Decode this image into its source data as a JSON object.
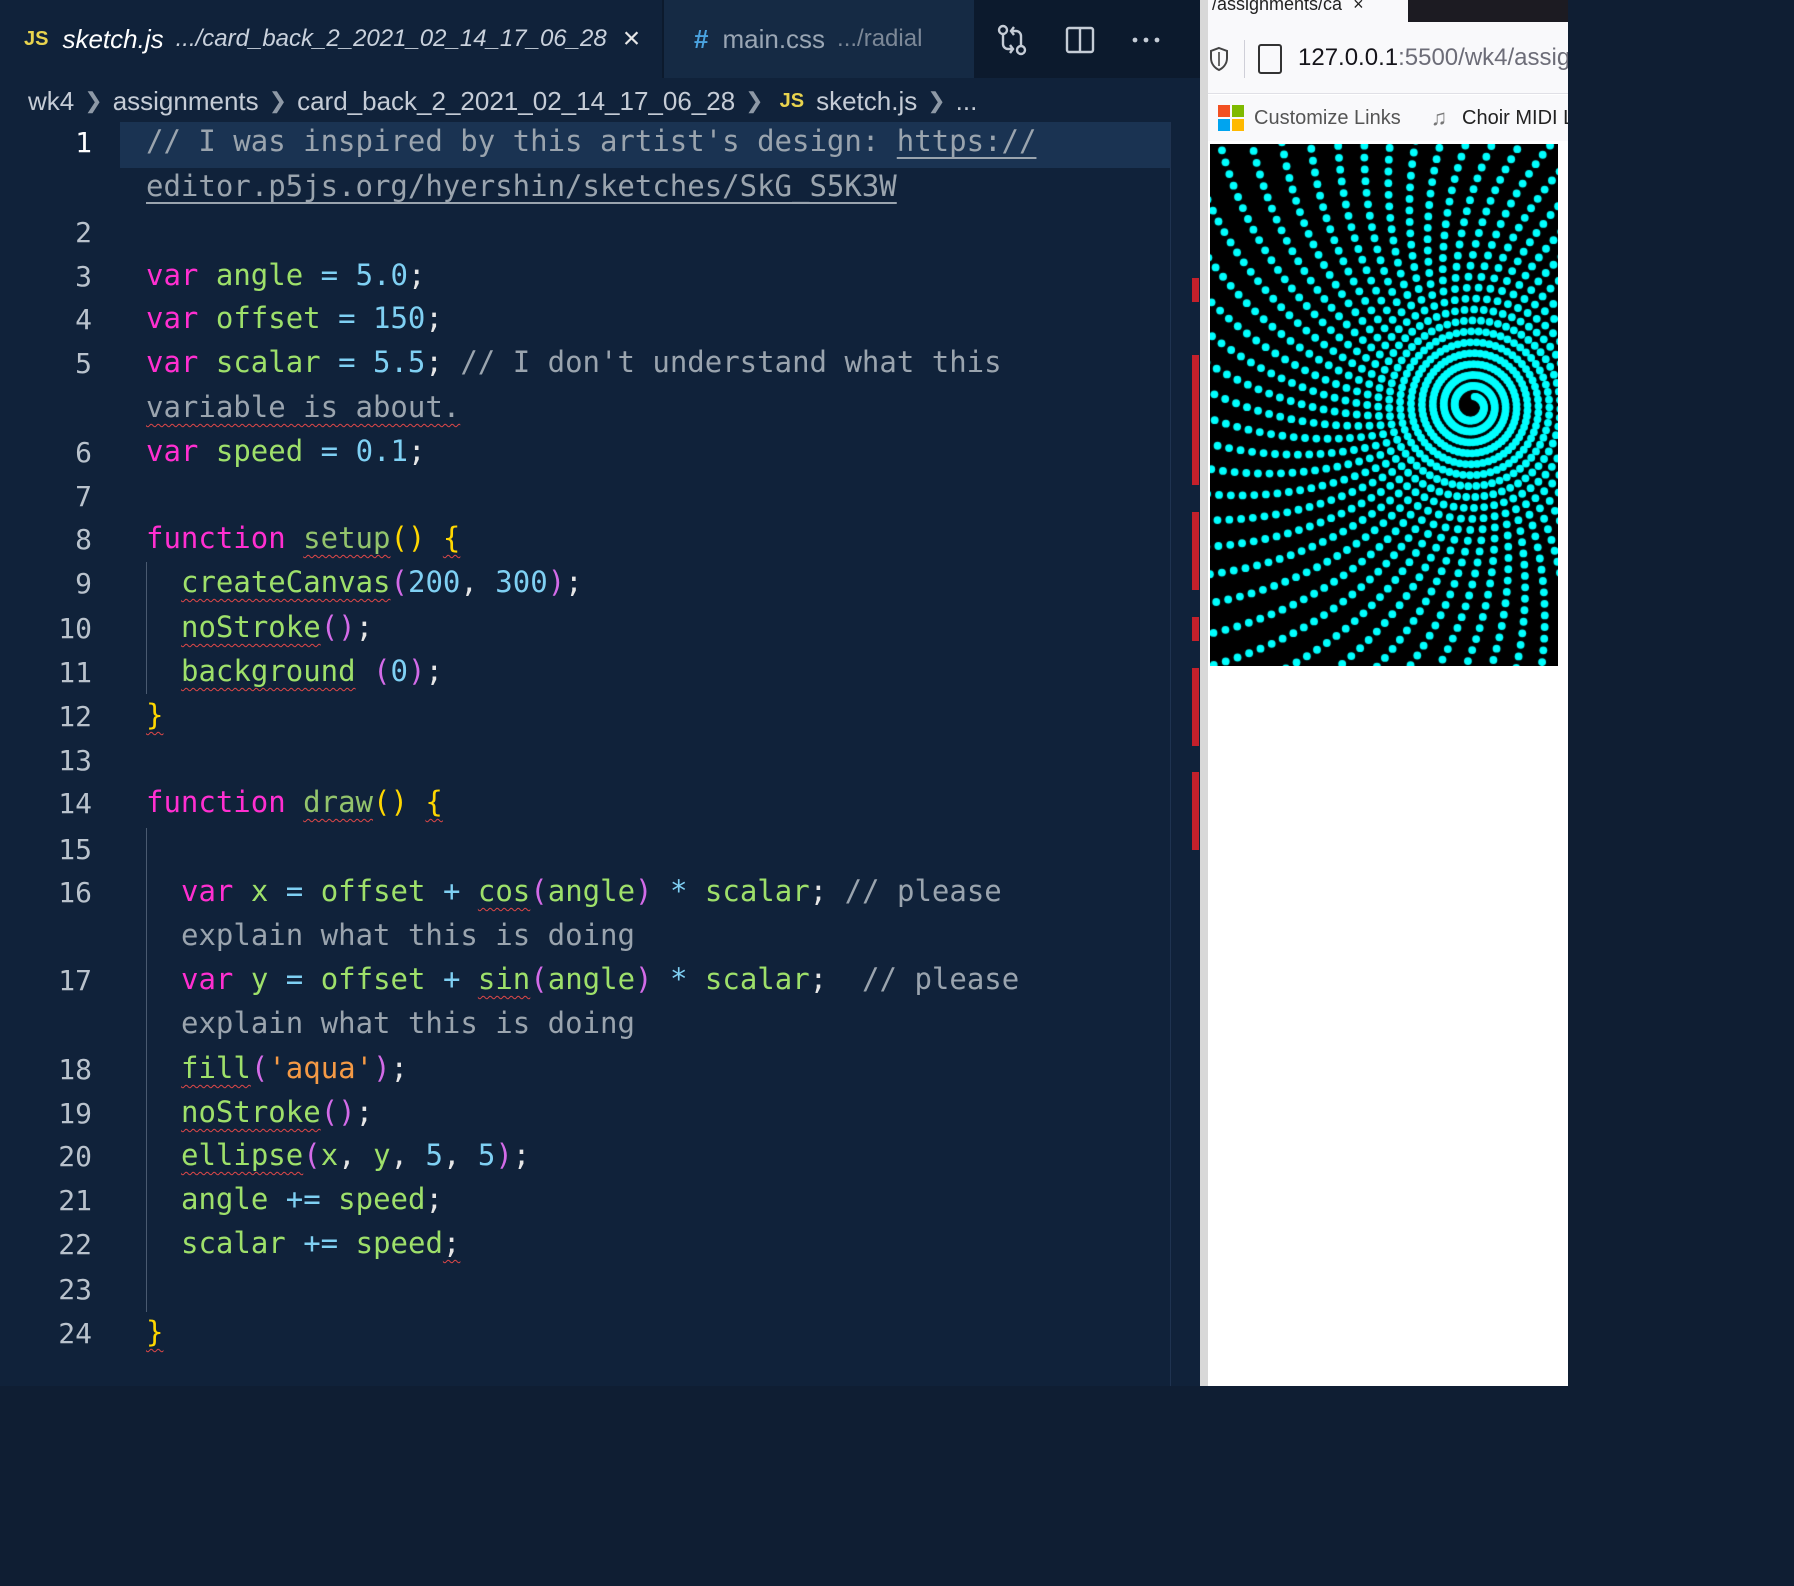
{
  "editor": {
    "tabs": [
      {
        "name": "sketch.js",
        "path": ".../card_back_2_2021_02_14_17_06_28",
        "badge": "JS",
        "active": true
      },
      {
        "name": "main.css",
        "path": ".../radial",
        "badge": "#",
        "active": false
      }
    ],
    "toolbar_icons": [
      "compare-changes-icon",
      "split-editor-icon",
      "more-actions-icon"
    ],
    "breadcrumb": [
      "wk4",
      "assignments",
      "card_back_2_2021_02_14_17_06_28",
      "sketch.js",
      "..."
    ],
    "breadcrumb_badge": "JS",
    "line_numbers": [
      "1",
      "2",
      "3",
      "4",
      "5",
      "6",
      "7",
      "8",
      "9",
      "10",
      "11",
      "12",
      "13",
      "14",
      "15",
      "16",
      "17",
      "18",
      "19",
      "20",
      "21",
      "22",
      "23",
      "24"
    ],
    "active_line": "1"
  },
  "code": {
    "l1": {
      "a": "// I was inspired by this artist's design: ",
      "link_a": "https://",
      "link_b": "editor.p5js.org/hyershin/sketches/SkG_S5K3W"
    },
    "l3": {
      "kw": "var",
      "id": "angle",
      "op": " = ",
      "val": "5.0",
      "end": ";"
    },
    "l4": {
      "kw": "var",
      "id": "offset",
      "op": " = ",
      "val": "150",
      "end": ";"
    },
    "l5": {
      "kw": "var",
      "id": "scalar",
      "op": " = ",
      "val": "5.5",
      "end": ";",
      "comment_a": " // I don't understand what this",
      "comment_b": "variable is about."
    },
    "l6": {
      "kw": "var",
      "id": "speed",
      "op": " = ",
      "val": "0.1",
      "end": ";"
    },
    "l8": {
      "kw": "function",
      "name": "setup",
      "parens": "()",
      "brace": "{"
    },
    "l9": {
      "fn": "createCanvas",
      "open": "(",
      "a": "200",
      "sep": ", ",
      "b": "300",
      "close": ")",
      "end": ";"
    },
    "l10": {
      "fn": "noStroke",
      "parens": "()",
      "end": ";"
    },
    "l11": {
      "fn": "background",
      "open": " (",
      "a": "0",
      "close": ")",
      "end": ";"
    },
    "l12": {
      "brace": "}"
    },
    "l14": {
      "kw": "function",
      "name": "draw",
      "parens": "()",
      "brace": "{"
    },
    "l16": {
      "kw": "var",
      "v": "x",
      "eq": " = ",
      "id1": "offset",
      "plus": " + ",
      "fn": "cos",
      "open": "(",
      "arg": "angle",
      "close": ")",
      "mul": " * ",
      "id2": "scalar",
      "end": ";",
      "comment_a": " // please",
      "comment_b": "explain what this is doing"
    },
    "l17": {
      "kw": "var",
      "v": "y",
      "eq": " = ",
      "id1": "offset",
      "plus": " + ",
      "fn": "sin",
      "open": "(",
      "arg": "angle",
      "close": ")",
      "mul": " * ",
      "id2": "scalar",
      "end": ";",
      "comment_a": "  // please",
      "comment_b": "explain what this is doing"
    },
    "l18": {
      "fn": "fill",
      "open": "(",
      "str": "'aqua'",
      "close": ")",
      "end": ";"
    },
    "l19": {
      "fn": "noStroke",
      "parens": "()",
      "end": ";"
    },
    "l20": {
      "fn": "ellipse",
      "open": "(",
      "a": "x",
      "sep1": ", ",
      "b": "y",
      "sep2": ", ",
      "c": "5",
      "sep3": ", ",
      "d": "5",
      "close": ")",
      "end": ";"
    },
    "l21": {
      "id": "angle",
      "op": " += ",
      "id2": "speed",
      "end": ";"
    },
    "l22": {
      "id": "scalar",
      "op": " += ",
      "id2": "speed",
      "end": ";"
    },
    "l24": {
      "brace": "}"
    }
  },
  "browser": {
    "tab_title": "/assignments/ca",
    "tab_close": "×",
    "url_host": "127.0.0.1",
    "url_rest": ":5500/wk4/assig",
    "bookmarks": [
      {
        "label": "Customize Links",
        "icon": "microsoft-logo-icon"
      },
      {
        "label": "Choir MIDI L",
        "icon": "midi-music-icon"
      }
    ],
    "sketch": {
      "background": "#000000",
      "dot_color": "#00ffff",
      "angle_start": 5.0,
      "scalar_start": 5.5,
      "speed": 0.1,
      "dot_size": 5
    }
  },
  "colors": {
    "editor_bg": "#10223a",
    "keyword": "#ff2fd0",
    "identifier": "#9ee06a",
    "number": "#7fd0f3",
    "comment": "#9aa4ae",
    "string": "#f59a45",
    "error_marker": "#c4202b"
  }
}
